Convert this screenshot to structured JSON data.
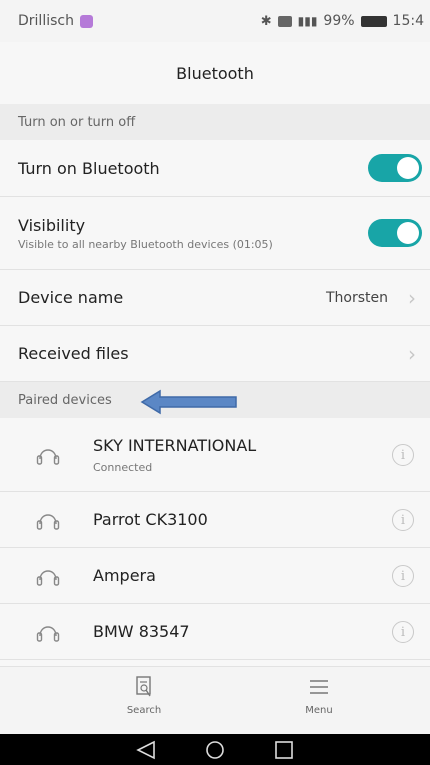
{
  "status_bar": {
    "carrier": "Drillisch",
    "battery": "99%",
    "time": "15:4"
  },
  "header": {
    "title": "Bluetooth"
  },
  "sections": {
    "toggle_header": "Turn on or turn off",
    "paired_header": "Paired devices"
  },
  "settings": {
    "bluetooth_label": "Turn on Bluetooth",
    "bluetooth_on": true,
    "visibility_label": "Visibility",
    "visibility_sub": "Visible to all nearby Bluetooth devices (01:05)",
    "visibility_on": true,
    "device_name_label": "Device name",
    "device_name_value": "Thorsten",
    "received_files_label": "Received files"
  },
  "paired_devices": [
    {
      "name": "SKY INTERNATIONAL",
      "status": "Connected"
    },
    {
      "name": "Parrot CK3100",
      "status": ""
    },
    {
      "name": "Ampera",
      "status": ""
    },
    {
      "name": "BMW 83547",
      "status": ""
    }
  ],
  "bottom_bar": {
    "search_label": "Search",
    "menu_label": "Menu"
  },
  "colors": {
    "toggle_on": "#18a5a7",
    "annotation_arrow": "#5b87c5"
  }
}
